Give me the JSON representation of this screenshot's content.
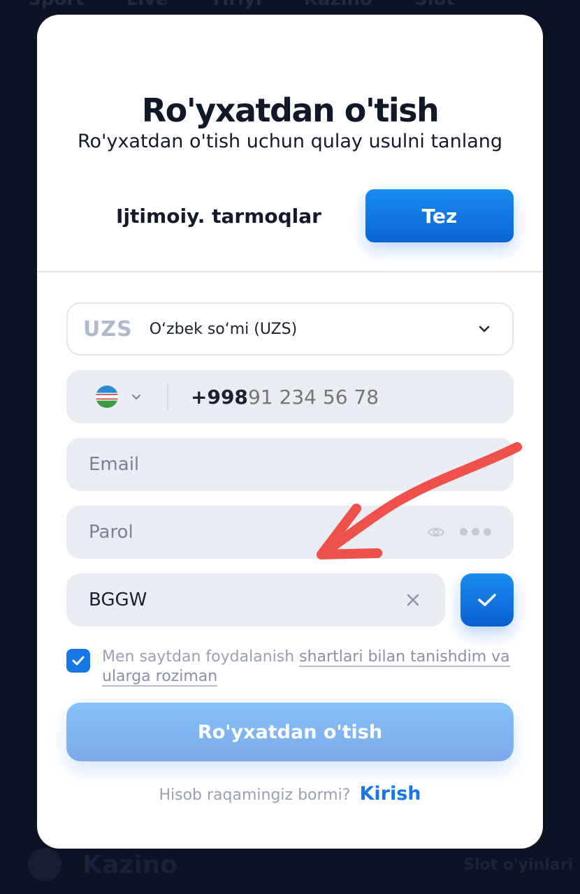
{
  "background": {
    "nav_items": [
      "Sport",
      "Live",
      "Tiriyi",
      "Kazino",
      "Slot"
    ],
    "bottom_label": "Kazino",
    "bottom_right": "Slot o'yinlari"
  },
  "modal": {
    "title": "Ro'yxatdan o'tish",
    "subtitle": "Ro'yxatdan o'tish uchun qulay usulni tanlang",
    "tabs": {
      "social": "Ijtimoiy. tarmoqlar",
      "fast": "Tez"
    },
    "currency": {
      "code": "UZS",
      "name": "O‘zbek so‘mi (UZS)"
    },
    "phone": {
      "prefix": "+998",
      "placeholder": "91 234 56 78"
    },
    "email": {
      "placeholder": "Email"
    },
    "password": {
      "placeholder": "Parol"
    },
    "promo": {
      "value": "BGGW"
    },
    "terms": {
      "text": "Men saytdan foydalanish ",
      "link": "shartlari bilan tanishdim va ularga roziman"
    },
    "submit_label": "Ro'yxatdan o'tish",
    "login": {
      "question": "Hisob raqamingiz bormi?",
      "link": "Kirish"
    }
  },
  "colors": {
    "accent": "#1877e6",
    "annotation_arrow": "#f0504a"
  }
}
